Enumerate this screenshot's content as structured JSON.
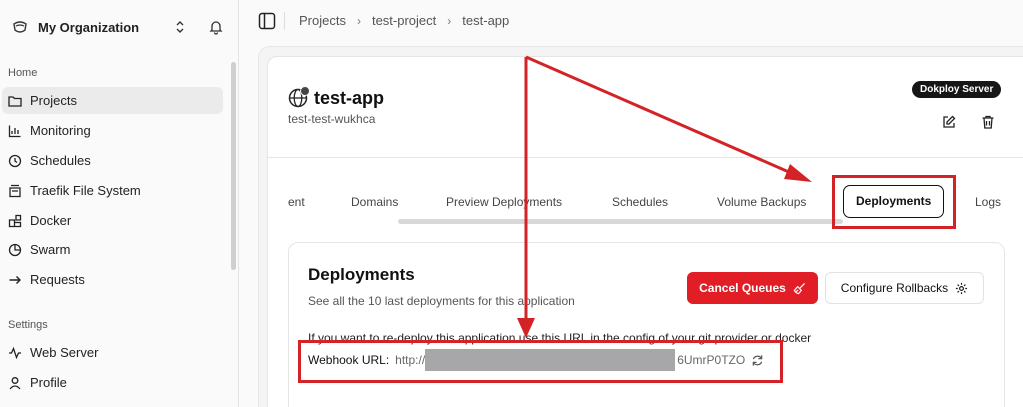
{
  "sidebar": {
    "org_name": "My Organization",
    "section_home": "Home",
    "section_settings": "Settings",
    "items": [
      {
        "label": "Projects",
        "icon": "folder-icon",
        "active": true
      },
      {
        "label": "Monitoring",
        "icon": "chart-icon"
      },
      {
        "label": "Schedules",
        "icon": "clock-icon"
      },
      {
        "label": "Traefik File System",
        "icon": "file-system-icon"
      },
      {
        "label": "Docker",
        "icon": "docker-icon"
      },
      {
        "label": "Swarm",
        "icon": "swarm-icon"
      },
      {
        "label": "Requests",
        "icon": "requests-icon"
      }
    ],
    "settings_items": [
      {
        "label": "Web Server",
        "icon": "activity-icon"
      },
      {
        "label": "Profile",
        "icon": "user-icon"
      }
    ]
  },
  "breadcrumb": [
    "Projects",
    "test-project",
    "test-app"
  ],
  "app": {
    "title": "test-app",
    "subtitle": "test-test-wukhca",
    "server_badge": "Dokploy Server"
  },
  "tabs": [
    {
      "label": "ent"
    },
    {
      "label": "Domains"
    },
    {
      "label": "Preview Deployments"
    },
    {
      "label": "Schedules"
    },
    {
      "label": "Volume Backups"
    },
    {
      "label": "Deployments",
      "active": true
    },
    {
      "label": "Logs"
    }
  ],
  "deployments": {
    "title": "Deployments",
    "description": "See all the 10 last deployments for this application",
    "cancel_button": "Cancel Queues",
    "rollback_button": "Configure Rollbacks",
    "webhook_note": "If you want to re-deploy this application use this URL in the config of your git provider or docker",
    "webhook_label": "Webhook URL:",
    "webhook_prefix": "http://",
    "webhook_suffix": "6UmrP0TZO"
  },
  "colors": {
    "accent_red": "#e11d25",
    "annotation_red": "#d32327"
  }
}
